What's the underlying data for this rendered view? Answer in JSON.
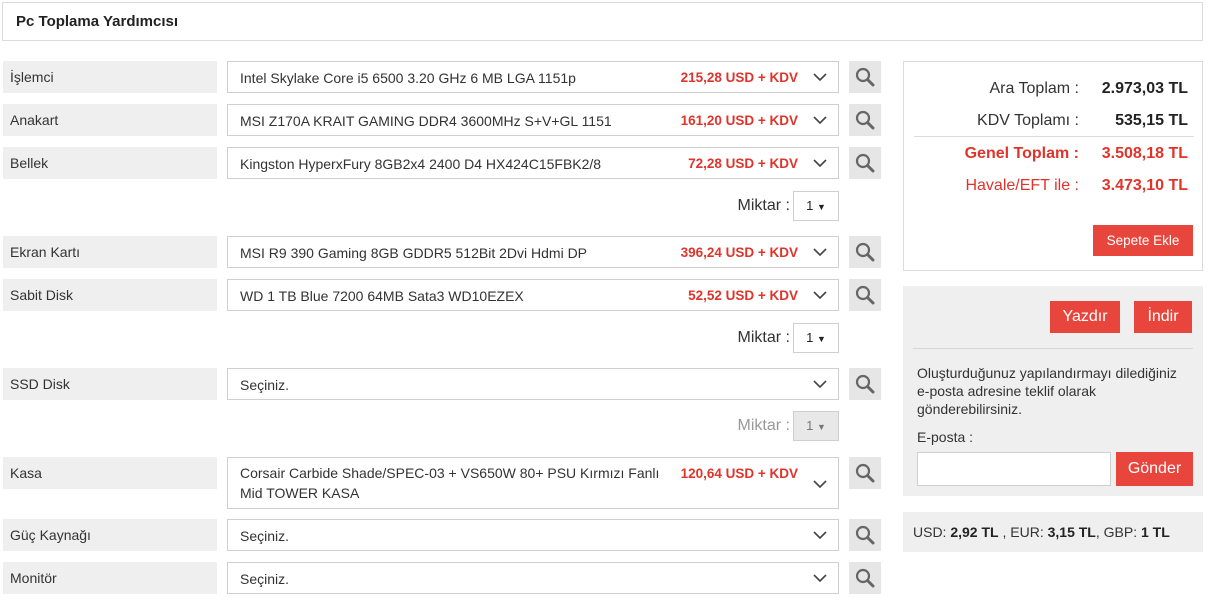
{
  "header": {
    "title": "Pc Toplama Yardımcısı"
  },
  "components": [
    {
      "label": "İşlemci",
      "product": "Intel Skylake Core i5 6500 3.20 GHz 6 MB LGA 1151p",
      "price": "215,28 USD + KDV"
    },
    {
      "label": "Anakart",
      "product": "MSI Z170A KRAIT GAMING DDR4 3600MHz S+V+GL 1151",
      "price": "161,20 USD + KDV"
    },
    {
      "label": "Bellek",
      "product": "Kingston HyperxFury 8GB2x4 2400 D4 HX424C15FBK2/8",
      "price": "72,28 USD + KDV"
    },
    {
      "label": "Ekran Kartı",
      "product": "MSI R9 390 Gaming 8GB GDDR5 512Bit 2Dvi Hdmi DP",
      "price": "396,24 USD + KDV"
    },
    {
      "label": "Sabit Disk",
      "product": "WD 1 TB Blue 7200 64MB Sata3 WD10EZEX",
      "price": "52,52 USD + KDV"
    },
    {
      "label": "SSD Disk",
      "product": "Seçiniz.",
      "price": ""
    },
    {
      "label": "Kasa",
      "product": "Corsair Carbide Shade/SPEC-03 + VS650W 80+ PSU Kırmızı Fanlı Mid TOWER KASA",
      "price": "120,64 USD + KDV"
    },
    {
      "label": "Güç Kaynağı",
      "product": "Seçiniz.",
      "price": ""
    },
    {
      "label": "Monitör",
      "product": "Seçiniz.",
      "price": ""
    }
  ],
  "quantity": {
    "label": "Miktar :",
    "memory": "1",
    "hdd": "1",
    "ssd": "1"
  },
  "summary": {
    "subtotal_label": "Ara Toplam :",
    "subtotal": "2.973,03 TL",
    "vat_label": "KDV Toplamı :",
    "vat": "535,15 TL",
    "grand_label": "Genel Toplam :",
    "grand": "3.508,18 TL",
    "transfer_label": "Havale/EFT ile :",
    "transfer": "3.473,10 TL",
    "cart_button": "Sepete Ekle"
  },
  "share": {
    "print_button": "Yazdır",
    "download_button": "İndir",
    "description": "Oluşturduğunuz yapılandırmayı dilediğiniz e-posta adresine teklif olarak gönderebilirsiniz.",
    "email_label": "E-posta :",
    "email_value": "",
    "send_button": "Gönder"
  },
  "currency": {
    "usd_label": "USD:",
    "usd": "2,92 TL",
    "eur_label": ", EUR:",
    "eur": "3,15 TL",
    "gbp_label": ", GBP:",
    "gbp": "1 TL"
  },
  "colors": {
    "accent": "#e8463c",
    "price": "#e0342b",
    "label_bg": "#efefef"
  },
  "icons": {
    "search": "search-icon",
    "dropdown": "chevron-down-icon"
  }
}
